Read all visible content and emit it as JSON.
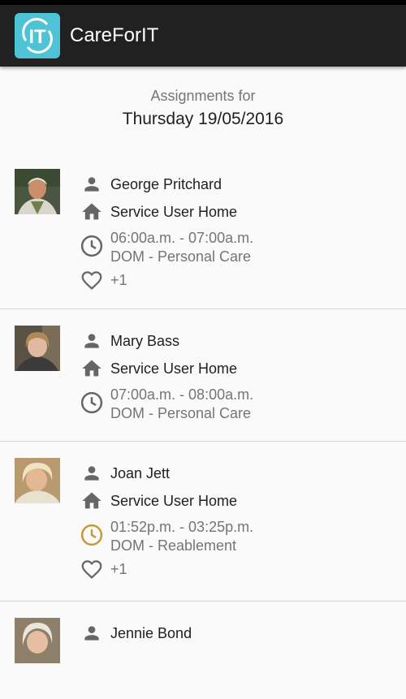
{
  "app": {
    "title": "CareForIT",
    "logo_text": "IT"
  },
  "header": {
    "subtitle": "Assignments for",
    "date": "Thursday 19/05/2016"
  },
  "assignments": [
    {
      "name": "George Pritchard",
      "location": "Service User Home",
      "time": "06:00a.m. - 07:00a.m.",
      "service": "DOM - Personal Care",
      "extra": "+1"
    },
    {
      "name": "Mary Bass",
      "location": "Service User Home",
      "time": "07:00a.m. - 08:00a.m.",
      "service": "DOM - Personal Care"
    },
    {
      "name": "Joan Jett",
      "location": "Service User Home",
      "time": "01:52p.m. - 03:25p.m.",
      "service": "DOM - Reablement",
      "extra": "+1"
    },
    {
      "name": "Jennie Bond"
    }
  ],
  "colors": {
    "accent": "#4ec3d5",
    "icon": "#666666",
    "clock_pending": "#c49b38"
  }
}
